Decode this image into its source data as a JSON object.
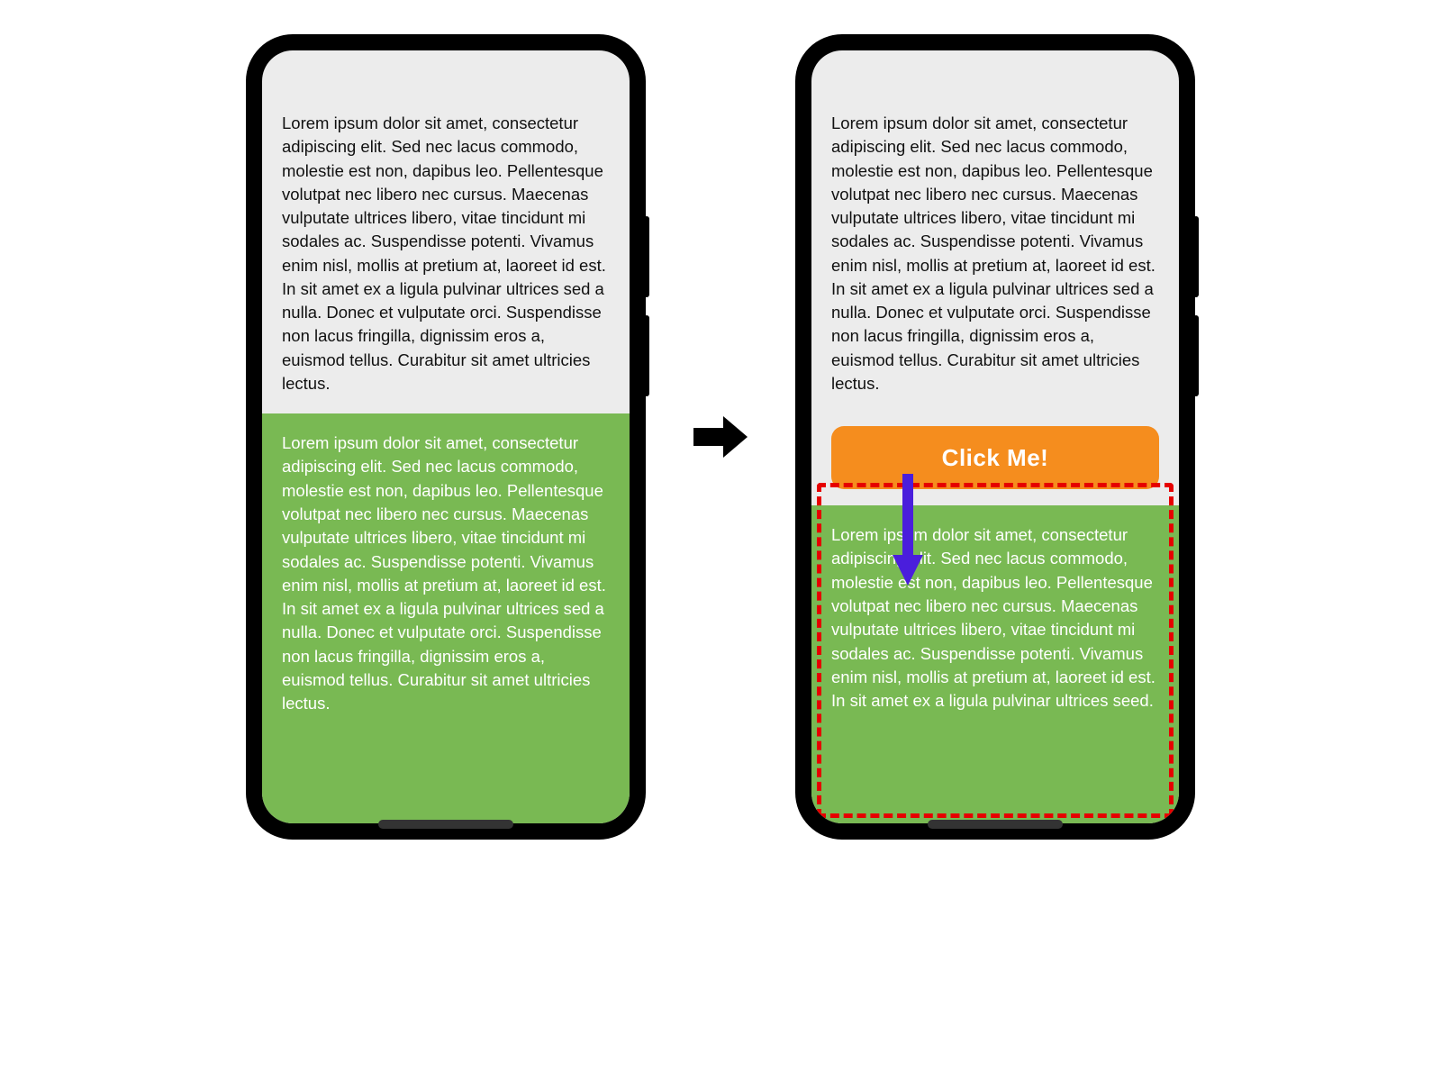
{
  "phone_left": {
    "top_text": "Lorem ipsum dolor sit amet, consectetur adipiscing elit. Sed nec lacus commodo, molestie est non, dapibus leo. Pellentesque volutpat nec libero nec cursus. Maecenas vulputate ultrices libero, vitae tincidunt mi sodales ac. Suspendisse potenti. Vivamus enim nisl, mollis at pretium at, laoreet id est. In sit amet ex a ligula pulvinar ultrices sed a nulla. Donec et vulputate orci. Suspendisse non lacus fringilla, dignissim eros a, euismod tellus. Curabitur sit amet ultricies lectus.",
    "green_text": "Lorem ipsum dolor sit amet, consectetur adipiscing elit. Sed nec lacus commodo, molestie est non, dapibus leo. Pellentesque volutpat nec libero nec cursus. Maecenas vulputate ultrices libero, vitae tincidunt mi sodales ac. Suspendisse potenti. Vivamus enim nisl, mollis at pretium at, laoreet id est. In sit amet ex a ligula pulvinar ultrices sed a nulla. Donec et vulputate orci. Suspendisse non lacus fringilla, dignissim eros a, euismod tellus. Curabitur sit amet ultricies lectus."
  },
  "phone_right": {
    "top_text": "Lorem ipsum dolor sit amet, consectetur adipiscing elit. Sed nec lacus commodo, molestie est non, dapibus leo. Pellentesque volutpat nec libero nec cursus. Maecenas vulputate ultrices libero, vitae tincidunt mi sodales ac. Suspendisse potenti. Vivamus enim nisl, mollis at pretium at, laoreet id est. In sit amet ex a ligula pulvinar ultrices sed a nulla. Donec et vulputate orci. Suspendisse non lacus fringilla, dignissim eros a, euismod tellus. Curabitur sit amet ultricies lectus.",
    "button_label": "Click Me!",
    "green_text": "Lorem ipsum dolor sit amet, consectetur adipiscing elit. Sed nec lacus commodo, molestie est non, dapibus leo. Pellentesque volutpat nec libero nec cursus. Maecenas vulputate ultrices libero, vitae tincidunt mi sodales ac. Suspendisse potenti. Vivamus enim nisl, mollis at pretium at, laoreet id est. In sit amet ex a ligula pulvinar ultrices seed."
  },
  "colors": {
    "phone_body": "#000000",
    "screen_bg": "#ececec",
    "green_block": "#79b953",
    "button_bg": "#f58d1e",
    "dashed_border": "#e60000",
    "down_arrow": "#4a1edc",
    "transition_arrow": "#000000"
  },
  "annotations": {
    "layout_shift_region": "dashed-red-box",
    "shift_direction_arrow": "downward-purple-arrow",
    "transition": "right-black-arrow"
  }
}
